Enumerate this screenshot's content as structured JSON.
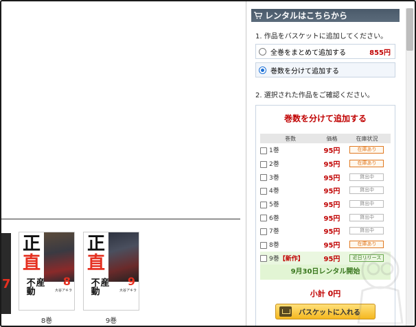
{
  "rental_panel": {
    "header_title": "レンタルはこちらから",
    "header_icon": "cart-icon",
    "step1_title": "1. 作品をバスケットに追加してください。",
    "options": [
      {
        "label": "全巻をまとめて追加する",
        "price": "855円",
        "selected": false
      },
      {
        "label": "巻数を分けて追加する",
        "price": "",
        "selected": true
      }
    ],
    "step2_title": "2. 選択された作品をご確認ください。",
    "box_title": "巻数を分けて追加する",
    "table_headers": [
      "巻数",
      "価格",
      "在庫状況"
    ],
    "rows": [
      {
        "volume": "1巻",
        "tag": "",
        "price": "95円",
        "status": "在庫あり",
        "kind": "avail"
      },
      {
        "volume": "2巻",
        "tag": "",
        "price": "95円",
        "status": "在庫あり",
        "kind": "avail"
      },
      {
        "volume": "3巻",
        "tag": "",
        "price": "95円",
        "status": "貸出中",
        "kind": "out"
      },
      {
        "volume": "4巻",
        "tag": "",
        "price": "95円",
        "status": "貸出中",
        "kind": "out"
      },
      {
        "volume": "5巻",
        "tag": "",
        "price": "95円",
        "status": "貸出中",
        "kind": "out"
      },
      {
        "volume": "6巻",
        "tag": "",
        "price": "95円",
        "status": "貸出中",
        "kind": "out"
      },
      {
        "volume": "7巻",
        "tag": "",
        "price": "95円",
        "status": "貸出中",
        "kind": "out"
      },
      {
        "volume": "8巻",
        "tag": "",
        "price": "95円",
        "status": "在庫あり",
        "kind": "avail"
      },
      {
        "volume": "9巻",
        "tag": "【新作】",
        "price": "95円",
        "status": "近日リリース",
        "kind": "new"
      }
    ],
    "release_notice": "9月30日レンタル開始",
    "subtotal": "小計 0円",
    "cart_button": "バスケットに入れる"
  },
  "volumes": [
    {
      "label": "8巻",
      "number": "8",
      "title_a": "正",
      "title_b": "直",
      "sub_a": "不動",
      "sub_b": "産",
      "author": "大谷アキラ"
    },
    {
      "label": "9巻",
      "number": "9",
      "title_a": "正",
      "title_b": "直",
      "sub_a": "不動",
      "sub_b": "産",
      "author": "大谷アキラ"
    }
  ],
  "partial_cover_number": "7",
  "colors": {
    "price_red": "#c00000",
    "header_bg": "#4a5a6a",
    "available": "#e07820",
    "new_release": "#6aa84f",
    "button_gold": "#f5b820"
  }
}
